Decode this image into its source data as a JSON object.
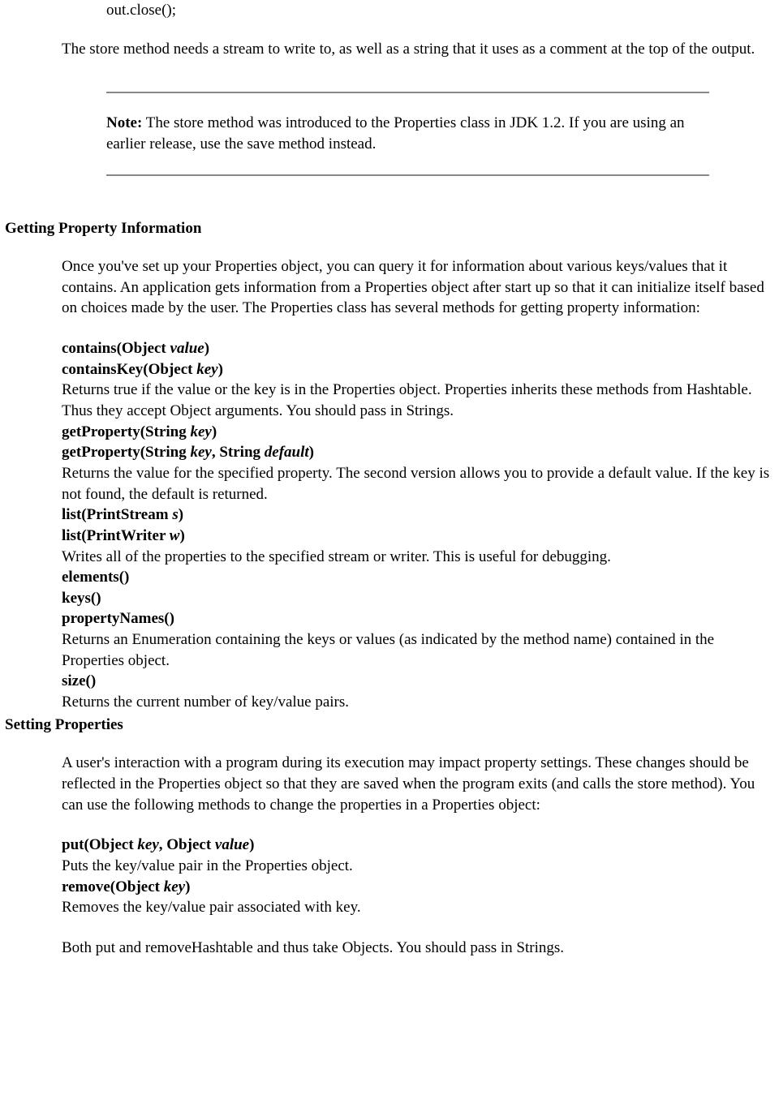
{
  "code_line": "out.close();",
  "store_explain": "The store method needs a stream to write to, as well as a string that it uses as a comment at the top of the output.",
  "note": {
    "label": "Note:",
    "text": "  The store method was introduced to the Properties class in JDK 1.2. If you are using an earlier release, use the save method instead."
  },
  "sec1": {
    "title": "Getting Property Information",
    "intro": "Once you've set up your Properties object, you can query it for information about various keys/values that it contains. An application gets information from a Properties object after start up so that it can initialize itself based on choices made by the user. The Properties class has several methods for getting property information:",
    "contains": {
      "pre": "contains(Object ",
      "arg": "value",
      "post": ")"
    },
    "containsKey": {
      "pre": "containsKey(Object ",
      "arg": "key",
      "post": ")"
    },
    "contains_desc": "Returns true if the value or the key is in the Properties object. Properties inherits these methods from Hashtable. Thus they accept Object arguments. You should pass in Strings.",
    "getProp1": {
      "pre": "getProperty(String ",
      "arg": "key",
      "post": ")"
    },
    "getProp2": {
      "pre": "getProperty(String ",
      "arg1": "key",
      "mid": ", String ",
      "arg2": "default",
      "post": ")"
    },
    "getProp_desc": "Returns the value for the specified property. The second version allows you to provide a default value. If the key is not found, the default is returned.",
    "list1": {
      "pre": "list(PrintStream ",
      "arg": "s",
      "post": ")"
    },
    "list2": {
      "pre": "list(PrintWriter ",
      "arg": "w",
      "post": ")"
    },
    "list_desc": "Writes all of the properties to the specified stream or writer. This is useful for debugging.",
    "elements": "elements()",
    "keys": "keys()",
    "propNames": "propertyNames()",
    "enum_desc": "Returns an Enumeration containing the keys or values (as indicated by the method name) contained in the Properties object.",
    "size": "size()",
    "size_desc": "Returns the current number of key/value pairs."
  },
  "sec2": {
    "title": "Setting Properties",
    "intro": "A user's interaction with a program during its execution may impact property settings. These changes should be reflected in the Properties object so that they are saved when the program exits (and calls the store method). You can use the following methods to change the properties in a Properties object:",
    "put": {
      "pre": "put(Object ",
      "arg1": "key",
      "mid": ", Object ",
      "arg2": "value",
      "post": ")"
    },
    "put_desc": "Puts the key/value pair in the Properties object.",
    "remove": {
      "pre": "remove(Object ",
      "arg": "key",
      "post": ")"
    },
    "remove_desc": "Removes the key/value pair associated with key.",
    "both_note": "Both put and removeHashtable and thus take Objects. You should pass in Strings."
  }
}
